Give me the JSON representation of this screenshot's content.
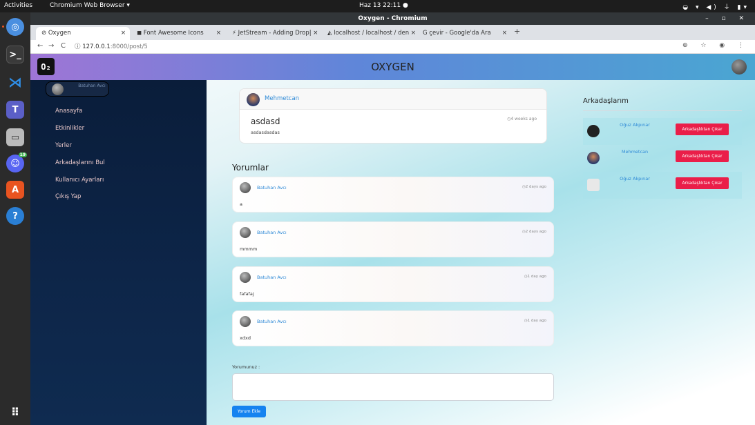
{
  "system": {
    "activities": "Activities",
    "app_name": "Chromium Web Browser ▾",
    "clock": "Haz 13  22:11  ●",
    "tray": "◒ ▾ ◀) ⏚ ▮▾"
  },
  "window": {
    "title": "Oxygen - Chromium",
    "controls": "–  ▫  ✕"
  },
  "tabs": [
    {
      "label": "⊘ Oxygen",
      "close": "×"
    },
    {
      "label": "◼ Font Awesome Icons",
      "close": "×"
    },
    {
      "label": "⚡ JetStream - Adding Drop| ×",
      "close": "×"
    },
    {
      "label": "◭ localhost / localhost / den ×",
      "close": "×"
    },
    {
      "label": "G çevir - Google'da Ara",
      "close": "×"
    }
  ],
  "new_tab": "+",
  "toolbar": {
    "back": "←",
    "forward": "→",
    "reload": "C",
    "url_host": "ⓘ 127.0.0.1",
    "url_path": ":8000/post/5",
    "right_icons": "⊕ ☆ ◉ ⋮"
  },
  "app": {
    "logo": "O₂",
    "brand": "OXYGEN"
  },
  "sidebar": {
    "profile_name": "Batuhan Avcı",
    "links": [
      "Anasayfa",
      "Etkinlikler",
      "Yerler",
      "Arkadaşlarını Bul",
      "Kullanıcı Ayarları",
      "Çıkış Yap"
    ]
  },
  "post": {
    "author": "Mehmetcan",
    "title": "asdasd",
    "body": "asdasdasdas",
    "time": "◷4 weeks ago"
  },
  "comments_title": "Yorumlar",
  "comments": [
    {
      "author": "Batuhan Avcı",
      "time": "◷2 days ago",
      "text": "a"
    },
    {
      "author": "Batuhan Avcı",
      "time": "◷2 days ago",
      "text": "mmmm"
    },
    {
      "author": "Batuhan Avcı",
      "time": "◷1 day ago",
      "text": "fafafaj"
    },
    {
      "author": "Batuhan Avcı",
      "time": "◷1 day ago",
      "text": "xdxd"
    }
  ],
  "form": {
    "label": "Yorumunuz :",
    "value": "",
    "submit": "Yorum Ekle"
  },
  "friends": {
    "title": "Arkadaşlarım",
    "items": [
      {
        "name": "Oğuz Akpınar",
        "button": "Arkadaşlıktan Çıkar"
      },
      {
        "name": "Mehmetcan",
        "button": "Arkadaşlıktan Çıkar"
      },
      {
        "name": "Oğuz Akpınar",
        "button": "Arkadaşlıktan Çıkar"
      }
    ]
  },
  "dock": {
    "icons": [
      "chromium-icon",
      "terminal-icon",
      "vscode-icon",
      "teams-icon",
      "files-icon",
      "discord-icon",
      "software-icon",
      "help-icon",
      "app-grid-icon"
    ],
    "discord_badge": "19"
  }
}
